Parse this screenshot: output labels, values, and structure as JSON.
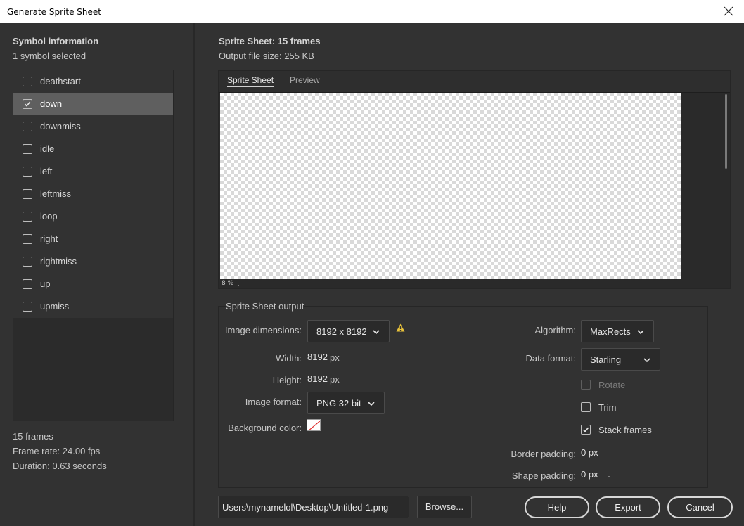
{
  "window": {
    "title": "Generate Sprite Sheet"
  },
  "symbol_info": {
    "heading": "Symbol information",
    "selected_count": "1 symbol selected",
    "items": [
      {
        "label": "deathstart",
        "checked": false
      },
      {
        "label": "down",
        "checked": true
      },
      {
        "label": "downmiss",
        "checked": false
      },
      {
        "label": "idle",
        "checked": false
      },
      {
        "label": "left",
        "checked": false
      },
      {
        "label": "leftmiss",
        "checked": false
      },
      {
        "label": "loop",
        "checked": false
      },
      {
        "label": "right",
        "checked": false
      },
      {
        "label": "rightmiss",
        "checked": false
      },
      {
        "label": "up",
        "checked": false
      },
      {
        "label": "upmiss",
        "checked": false
      }
    ],
    "frames": "15 frames",
    "frame_rate": "Frame rate: 24.00 fps",
    "duration": "Duration: 0.63 seconds"
  },
  "sprite_sheet": {
    "heading": "Sprite Sheet: 15 frames",
    "file_size": "Output file size: 255 KB",
    "tabs": [
      "Sprite Sheet",
      "Preview"
    ],
    "active_tab": "Sprite Sheet",
    "zoom": "8 %"
  },
  "output": {
    "legend": "Sprite Sheet output",
    "image_dimensions_label": "Image dimensions:",
    "image_dimensions_value": "8192 x 8192",
    "width_label": "Width:",
    "width_value": "8192",
    "width_unit": "px",
    "height_label": "Height:",
    "height_value": "8192",
    "height_unit": "px",
    "image_format_label": "Image format:",
    "image_format_value": "PNG 32 bit",
    "background_color_label": "Background color:",
    "algorithm_label": "Algorithm:",
    "algorithm_value": "MaxRects",
    "data_format_label": "Data format:",
    "data_format_value": "Starling",
    "rotate_label": "Rotate",
    "rotate_checked": false,
    "trim_label": "Trim",
    "trim_checked": false,
    "stack_frames_label": "Stack frames",
    "stack_frames_checked": true,
    "border_padding_label": "Border padding:",
    "border_padding_value": "0 px",
    "shape_padding_label": "Shape padding:",
    "shape_padding_value": "0 px"
  },
  "footer": {
    "path": "Users\\mynamelol\\Desktop\\Untitled-1.png",
    "browse": "Browse...",
    "help": "Help",
    "export": "Export",
    "cancel": "Cancel"
  },
  "icons": {
    "close": "close-icon",
    "warning": "warning-icon",
    "chevron": "chevron-down-icon",
    "check": "check-icon"
  },
  "colors": {
    "warning": "#e8c23a",
    "selected_row": "#5f5f5f",
    "background": "#323232"
  }
}
